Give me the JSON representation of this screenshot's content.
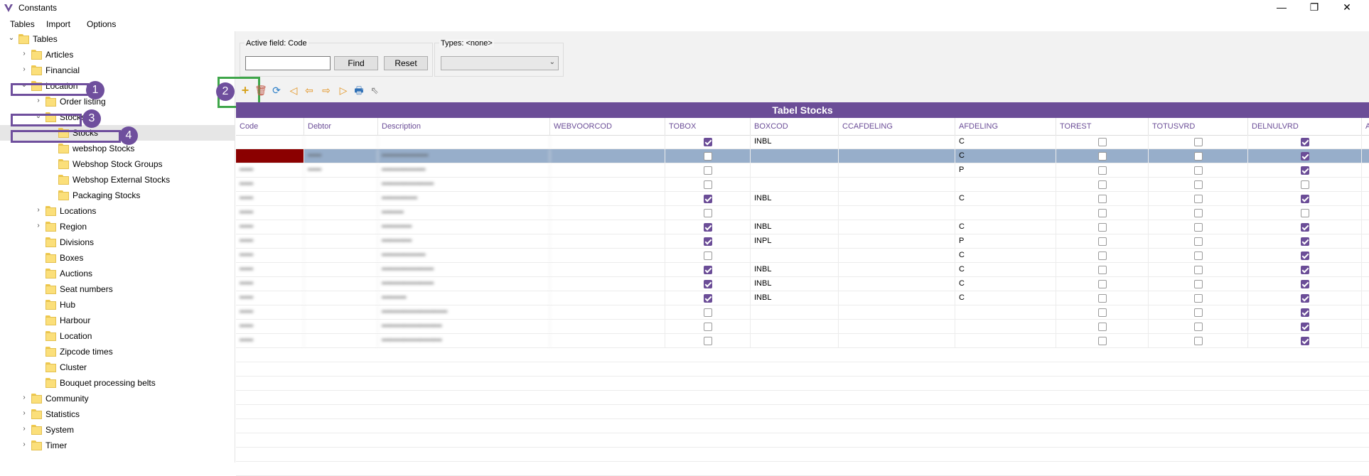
{
  "window": {
    "title": "Constants",
    "minimize": "—",
    "restore": "❐",
    "close": "✕"
  },
  "menu": [
    "Tables",
    "Import",
    "Options"
  ],
  "tree": [
    {
      "label": "Tables",
      "level": 0,
      "exp": "v"
    },
    {
      "label": "Articles",
      "level": 1,
      "exp": ">"
    },
    {
      "label": "Financial",
      "level": 1,
      "exp": ">"
    },
    {
      "label": "Location",
      "level": 1,
      "exp": "v"
    },
    {
      "label": "Order listing",
      "level": 2,
      "exp": ">"
    },
    {
      "label": "Stocks",
      "level": 2,
      "exp": "v"
    },
    {
      "label": "Stocks",
      "level": 3,
      "exp": "",
      "selected": true
    },
    {
      "label": "webshop Stocks",
      "level": 3,
      "exp": ""
    },
    {
      "label": "Webshop Stock Groups",
      "level": 3,
      "exp": ""
    },
    {
      "label": "Webshop External Stocks",
      "level": 3,
      "exp": ""
    },
    {
      "label": "Packaging Stocks",
      "level": 3,
      "exp": ""
    },
    {
      "label": "Locations",
      "level": 2,
      "exp": ">"
    },
    {
      "label": "Region",
      "level": 2,
      "exp": ">"
    },
    {
      "label": "Divisions",
      "level": 2,
      "exp": ""
    },
    {
      "label": "Boxes",
      "level": 2,
      "exp": ""
    },
    {
      "label": "Auctions",
      "level": 2,
      "exp": ""
    },
    {
      "label": "Seat numbers",
      "level": 2,
      "exp": ""
    },
    {
      "label": "Hub",
      "level": 2,
      "exp": ""
    },
    {
      "label": "Harbour",
      "level": 2,
      "exp": ""
    },
    {
      "label": "Location",
      "level": 2,
      "exp": ""
    },
    {
      "label": "Zipcode times",
      "level": 2,
      "exp": ""
    },
    {
      "label": "Cluster",
      "level": 2,
      "exp": ""
    },
    {
      "label": "Bouquet processing belts",
      "level": 2,
      "exp": ""
    },
    {
      "label": "Community",
      "level": 1,
      "exp": ">"
    },
    {
      "label": "Statistics",
      "level": 1,
      "exp": ">"
    },
    {
      "label": "System",
      "level": 1,
      "exp": ">"
    },
    {
      "label": "Timer",
      "level": 1,
      "exp": ">"
    }
  ],
  "callouts": [
    "1",
    "2",
    "3",
    "4"
  ],
  "search": {
    "active_field_label": "Active field: Code",
    "find_label": "Find",
    "reset_label": "Reset",
    "types_label": "Types: <none>"
  },
  "toolbar": [
    "add-icon",
    "delete-icon",
    "refresh-icon",
    "first-icon",
    "prev-icon",
    "next-icon",
    "last-icon",
    "print-icon",
    "pointer-icon"
  ],
  "grid": {
    "title": "Tabel Stocks",
    "columns": [
      "Code",
      "Debtor",
      "Description",
      "WEBVOORCOD",
      "TOBOX",
      "BOXCOD",
      "CCAFDELING",
      "AFDELING",
      "TOREST",
      "TOTUSVRD",
      "DELNULVRD",
      "A"
    ],
    "rows": [
      {
        "code": "",
        "debtor": "",
        "desc": "",
        "tobox": true,
        "boxcod": "INBL",
        "afd": "C",
        "torest": false,
        "totus": false,
        "deln": true,
        "hl": false
      },
      {
        "code": "•••••",
        "debtor": "•••••",
        "desc": "•••••••••••••••••",
        "tobox": false,
        "boxcod": "",
        "afd": "C",
        "torest": false,
        "totus": false,
        "deln": true,
        "hl": true
      },
      {
        "code": "•••••",
        "debtor": "•••••",
        "desc": "••••••••••••••••",
        "tobox": false,
        "boxcod": "",
        "afd": "P",
        "torest": false,
        "totus": false,
        "deln": true,
        "hl": false
      },
      {
        "code": "•••••",
        "debtor": "",
        "desc": "•••••••••••••••••••",
        "tobox": false,
        "boxcod": "",
        "afd": "",
        "torest": false,
        "totus": false,
        "deln": false,
        "hl": false
      },
      {
        "code": "•••••",
        "debtor": "",
        "desc": "•••••••••••••",
        "tobox": true,
        "boxcod": "INBL",
        "afd": "C",
        "torest": false,
        "totus": false,
        "deln": true,
        "hl": false
      },
      {
        "code": "•••••",
        "debtor": "",
        "desc": "••••••••",
        "tobox": false,
        "boxcod": "",
        "afd": "",
        "torest": false,
        "totus": false,
        "deln": false,
        "hl": false
      },
      {
        "code": "•••••",
        "debtor": "",
        "desc": "•••••••••••",
        "tobox": true,
        "boxcod": "INBL",
        "afd": "C",
        "torest": false,
        "totus": false,
        "deln": true,
        "hl": false
      },
      {
        "code": "•••••",
        "debtor": "",
        "desc": "•••••••••••",
        "tobox": true,
        "boxcod": "INPL",
        "afd": "P",
        "torest": false,
        "totus": false,
        "deln": true,
        "hl": false
      },
      {
        "code": "•••••",
        "debtor": "",
        "desc": "••••••••••••••••",
        "tobox": false,
        "boxcod": "",
        "afd": "C",
        "torest": false,
        "totus": false,
        "deln": true,
        "hl": false
      },
      {
        "code": "•••••",
        "debtor": "",
        "desc": "•••••••••••••••••••",
        "tobox": true,
        "boxcod": "INBL",
        "afd": "C",
        "torest": false,
        "totus": false,
        "deln": true,
        "hl": false
      },
      {
        "code": "•••••",
        "debtor": "",
        "desc": "•••••••••••••••••••",
        "tobox": true,
        "boxcod": "INBL",
        "afd": "C",
        "torest": false,
        "totus": false,
        "deln": true,
        "hl": false
      },
      {
        "code": "•••••",
        "debtor": "",
        "desc": "•••••••••",
        "tobox": true,
        "boxcod": "INBL",
        "afd": "C",
        "torest": false,
        "totus": false,
        "deln": true,
        "hl": false
      },
      {
        "code": "•••••",
        "debtor": "",
        "desc": "••••••••••••••••••••••••",
        "tobox": false,
        "boxcod": "",
        "afd": "",
        "torest": false,
        "totus": false,
        "deln": true,
        "hl": false
      },
      {
        "code": "•••••",
        "debtor": "",
        "desc": "••••••••••••••••••••••",
        "tobox": false,
        "boxcod": "",
        "afd": "",
        "torest": false,
        "totus": false,
        "deln": true,
        "hl": false
      },
      {
        "code": "•••••",
        "debtor": "",
        "desc": "••••••••••••••••••••••",
        "tobox": false,
        "boxcod": "",
        "afd": "",
        "torest": false,
        "totus": false,
        "deln": true,
        "hl": false
      }
    ]
  },
  "colors": {
    "accent": "#6b4d97",
    "highlight_row": "#97aeca",
    "selected_code": "#8b0000"
  }
}
